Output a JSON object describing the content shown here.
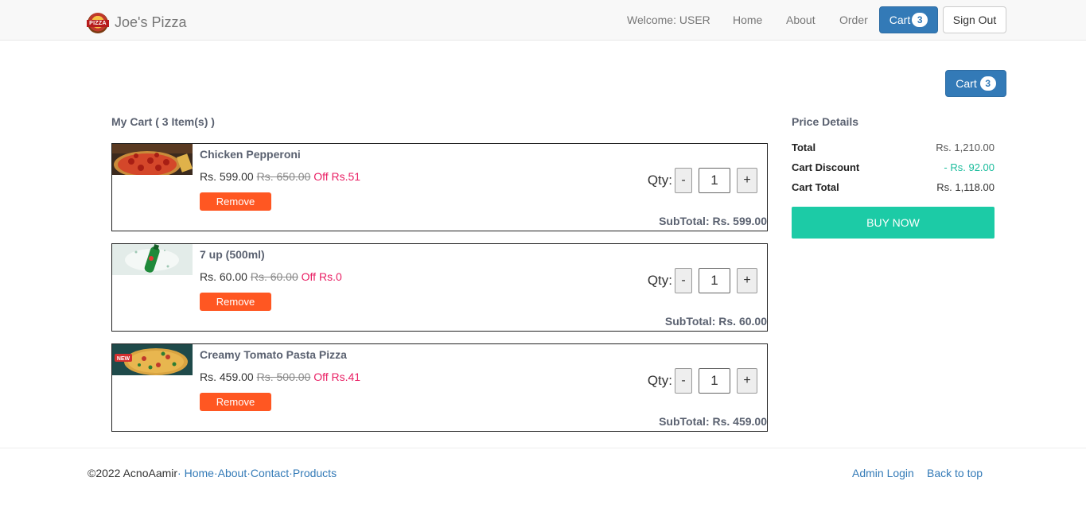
{
  "brand": {
    "name": "Joe's Pizza",
    "logo_text": "PIZZA"
  },
  "nav": {
    "welcome": "Welcome: USER",
    "home": "Home",
    "about": "About",
    "order": "Order",
    "cart_label": "Cart",
    "cart_count": "3",
    "signout": "Sign Out"
  },
  "cart_button": {
    "label": "Cart",
    "count": "3"
  },
  "cart": {
    "title": "My Cart ( 3 Item(s) )",
    "qty_label": "Qty:",
    "remove_label": "Remove",
    "minus": "-",
    "plus": "+",
    "items": [
      {
        "name": "Chicken Pepperoni",
        "price": "Rs.  599.00",
        "original": "Rs.  650.00",
        "off": "Off Rs.51",
        "qty": "1",
        "subtotal": "SubTotal: Rs.  599.00",
        "image": "pepperoni-pizza-image"
      },
      {
        "name": "7 up (500ml)",
        "price": "Rs.  60.00",
        "original": "Rs.  60.00",
        "off": "Off Rs.0",
        "qty": "1",
        "subtotal": "SubTotal: Rs.  60.00",
        "image": "7up-bottle-image"
      },
      {
        "name": "Creamy Tomato Pasta Pizza",
        "price": "Rs.  459.00",
        "original": "Rs.  500.00",
        "off": "Off Rs.41",
        "qty": "1",
        "subtotal": "SubTotal: Rs.  459.00",
        "image": "pasta-pizza-image",
        "image_tag": "NEW"
      }
    ]
  },
  "price_details": {
    "title": "Price Details",
    "total_label": "Total",
    "total_value": "Rs. 1,210.00",
    "discount_label": "Cart Discount",
    "discount_value": "- Rs. 92.00",
    "cart_total_label": "Cart Total",
    "cart_total_value": "Rs. 1,118.00",
    "buy_label": "BUY NOW"
  },
  "footer": {
    "copyright": "©2022 AcnoAamir",
    "sep": "·",
    "links": [
      "Home",
      "About",
      "Contact",
      "Products"
    ],
    "admin_login": "Admin Login",
    "back_to_top": "Back to top"
  },
  "colors": {
    "primary": "#337ab7",
    "remove": "#ff5722",
    "buy": "#1ccba6",
    "discount": "#1abc9c",
    "off": "#e91e63"
  }
}
